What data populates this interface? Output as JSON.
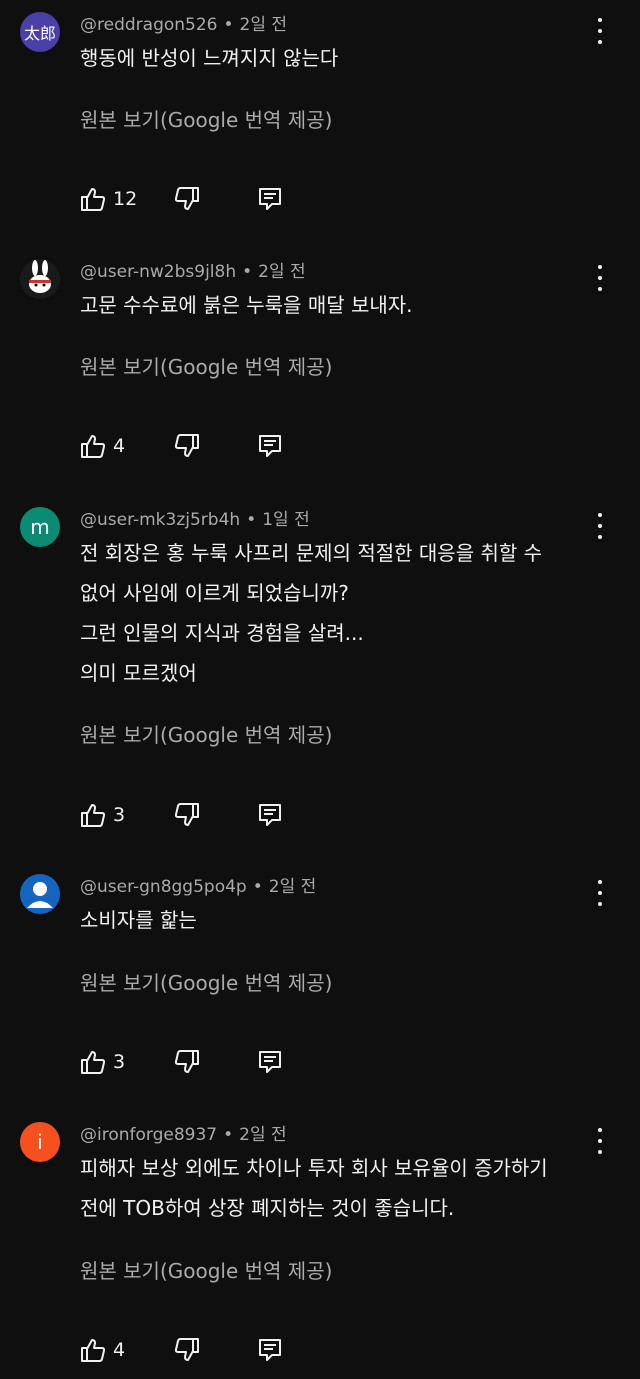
{
  "theme": {
    "background": "#0f0f0f",
    "text": "#f1f1f1",
    "muted": "#aaaaaa"
  },
  "comments": [
    {
      "handle": "@reddragon526",
      "time": "2일 전",
      "avatar": {
        "text": "太郎",
        "color": "#4b3fa8"
      },
      "lines": [
        "행동에 반성이 느껴지지 않는다"
      ],
      "translate": "원본 보기(Google 번역 제공)",
      "likes": "12"
    },
    {
      "handle": "@user-nw2bs9jl8h",
      "time": "2일 전",
      "avatar": {
        "text": "",
        "color": "#1a1a1a"
      },
      "lines": [
        "고문 수수료에 붉은 누룩을 매달 보내자."
      ],
      "translate": "원본 보기(Google 번역 제공)",
      "likes": "4"
    },
    {
      "handle": "@user-mk3zj5rb4h",
      "time": "1일 전",
      "avatar": {
        "text": "m",
        "color": "#0b8a74"
      },
      "lines": [
        "전 회장은 홍 누룩 사프리 문제의 적절한 대응을 취할 수",
        "없어 사임에 이르게 되었습니까?",
        "그런 인물의 지식과 경험을 살려...",
        "의미 모르겠어"
      ],
      "translate": "원본 보기(Google 번역 제공)",
      "likes": "3"
    },
    {
      "handle": "@user-gn8gg5po4p",
      "time": "2일 전",
      "avatar": {
        "text": "",
        "color": "#1565c0"
      },
      "lines": [
        "소비자를 핥는"
      ],
      "translate": "원본 보기(Google 번역 제공)",
      "likes": "3"
    },
    {
      "handle": "@ironforge8937",
      "time": "2일 전",
      "avatar": {
        "text": "i",
        "color": "#f4511e"
      },
      "lines": [
        "피해자 보상 외에도 차이나 투자 회사 보유율이 증가하기",
        "전에 TOB하여 상장 폐지하는 것이 좋습니다."
      ],
      "translate": "원본 보기(Google 번역 제공)",
      "likes": "4"
    }
  ]
}
